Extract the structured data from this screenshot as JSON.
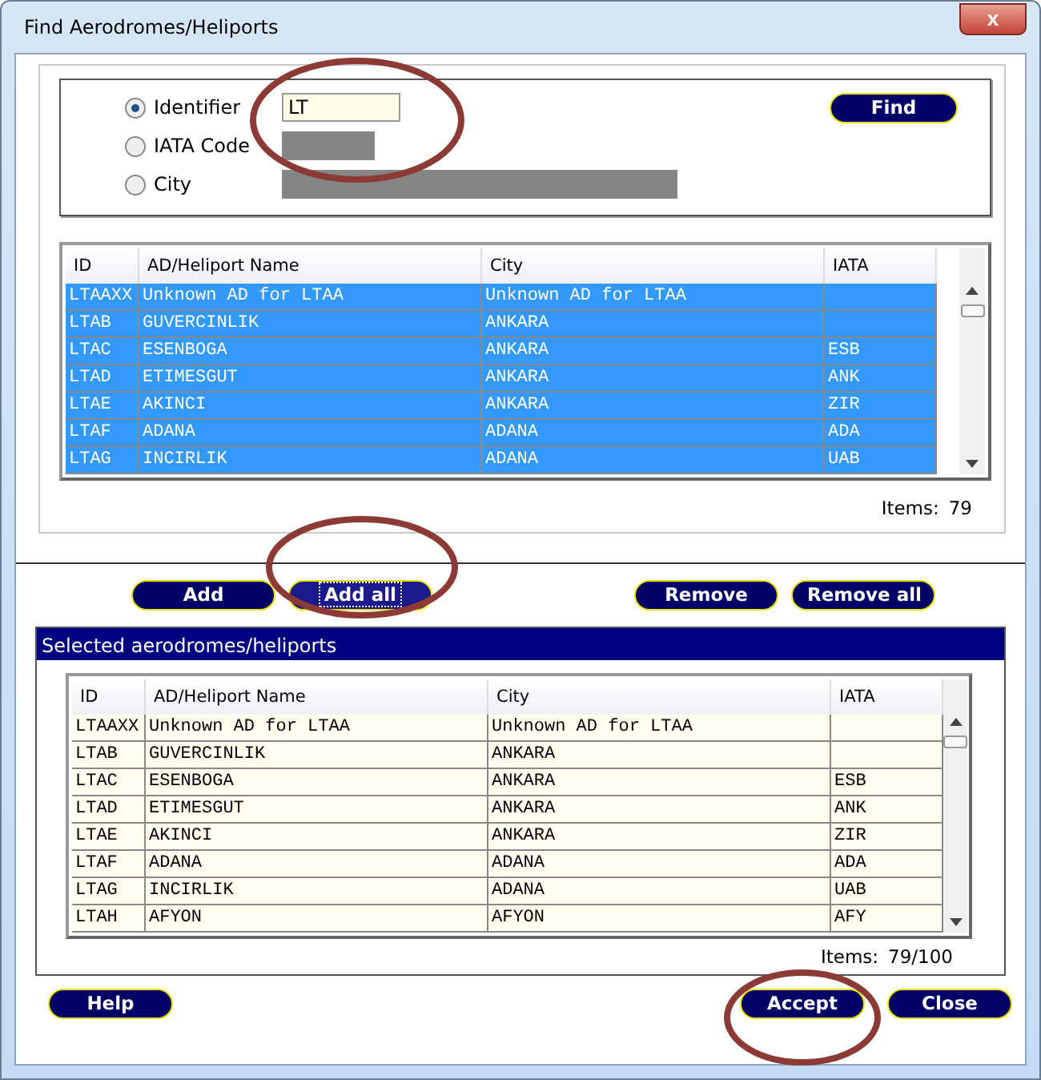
{
  "window": {
    "title": "Find Aerodromes/Heliports",
    "close": "x"
  },
  "search": {
    "options": [
      {
        "label": "Identifier",
        "selected": true,
        "value": "LT",
        "disabled": false,
        "kind": "short"
      },
      {
        "label": "IATA Code",
        "selected": false,
        "disabled": true,
        "kind": "short"
      },
      {
        "label": "City",
        "selected": false,
        "disabled": true,
        "kind": "long"
      }
    ],
    "find_button": "Find"
  },
  "results": {
    "columns": [
      "ID",
      "AD/Heliport Name",
      "City",
      "IATA"
    ],
    "rows": [
      {
        "cells": [
          "LTAAXX",
          "Unknown AD for LTAA",
          "Unknown AD for LTAA",
          ""
        ],
        "selected": true
      },
      {
        "cells": [
          "LTAB",
          "GUVERCINLIK",
          "ANKARA",
          ""
        ],
        "selected": true
      },
      {
        "cells": [
          "LTAC",
          "ESENBOGA",
          "ANKARA",
          "ESB"
        ],
        "selected": true
      },
      {
        "cells": [
          "LTAD",
          "ETIMESGUT",
          "ANKARA",
          "ANK"
        ],
        "selected": true
      },
      {
        "cells": [
          "LTAE",
          "AKINCI",
          "ANKARA",
          "ZIR"
        ],
        "selected": true
      },
      {
        "cells": [
          "LTAF",
          "ADANA",
          "ADANA",
          "ADA"
        ],
        "selected": true
      },
      {
        "cells": [
          "LTAG",
          "INCIRLIK",
          "ADANA",
          "UAB"
        ],
        "selected": true
      }
    ],
    "items_label": "Items:",
    "items_count": "79"
  },
  "add_actions": [
    {
      "label": "Add",
      "focused": false
    },
    {
      "label": "Add all",
      "focused": true
    }
  ],
  "remove_actions": [
    {
      "label": "Remove",
      "focused": false
    },
    {
      "label": "Remove all",
      "focused": false
    }
  ],
  "selected_section": {
    "title": "Selected aerodromes/heliports",
    "columns": [
      "ID",
      "AD/Heliport Name",
      "City",
      "IATA"
    ],
    "rows": [
      {
        "cells": [
          "LTAAXX",
          "Unknown AD for LTAA",
          "Unknown AD for LTAA",
          ""
        ],
        "selected": false
      },
      {
        "cells": [
          "LTAB",
          "GUVERCINLIK",
          "ANKARA",
          ""
        ],
        "selected": false
      },
      {
        "cells": [
          "LTAC",
          "ESENBOGA",
          "ANKARA",
          "ESB"
        ],
        "selected": false
      },
      {
        "cells": [
          "LTAD",
          "ETIMESGUT",
          "ANKARA",
          "ANK"
        ],
        "selected": false
      },
      {
        "cells": [
          "LTAE",
          "AKINCI",
          "ANKARA",
          "ZIR"
        ],
        "selected": false
      },
      {
        "cells": [
          "LTAF",
          "ADANA",
          "ADANA",
          "ADA"
        ],
        "selected": false
      },
      {
        "cells": [
          "LTAG",
          "INCIRLIK",
          "ADANA",
          "UAB"
        ],
        "selected": false
      },
      {
        "cells": [
          "LTAH",
          "AFYON",
          "AFYON",
          "AFY"
        ],
        "selected": false
      }
    ],
    "items_label": "Items:",
    "items_count": "79/100"
  },
  "footer": {
    "help": "Help",
    "accept": "Accept",
    "close": "Close"
  }
}
